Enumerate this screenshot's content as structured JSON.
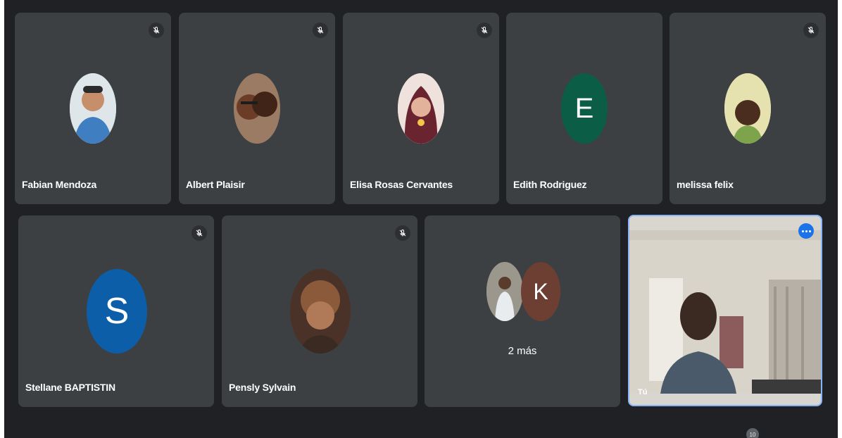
{
  "participants_row1": [
    {
      "name": "Fabian Mendoza",
      "avatar": "photo",
      "muted": true
    },
    {
      "name": "Albert Plaisir",
      "avatar": "photo",
      "muted": true
    },
    {
      "name": "Elisa Rosas Cervantes",
      "avatar": "photo",
      "muted": true
    },
    {
      "name": "Edith Rodriguez",
      "avatar_letter": "E",
      "avatar_color": "#0b5e45",
      "muted": true
    },
    {
      "name": "melissa felix",
      "avatar": "photo",
      "muted": true
    }
  ],
  "participants_row2": [
    {
      "name": "Stellane BAPTISTIN",
      "avatar_letter": "S",
      "avatar_color": "#0d5ea8",
      "muted": true
    },
    {
      "name": "Pensly Sylvain",
      "avatar": "photo",
      "muted": true
    }
  ],
  "overflow_tile": {
    "more_label": "2 más",
    "avatar_letter": "K",
    "avatar_color": "#6d3f32"
  },
  "self_view": {
    "label": "Tú",
    "highlight_color": "#8ab4f8"
  },
  "footer": {
    "participant_count": "10"
  },
  "colors": {
    "background": "#202124",
    "tile": "#3c4043",
    "accent": "#1a73e8"
  },
  "icons": [
    "microphone-off-icon",
    "more-options-icon"
  ]
}
